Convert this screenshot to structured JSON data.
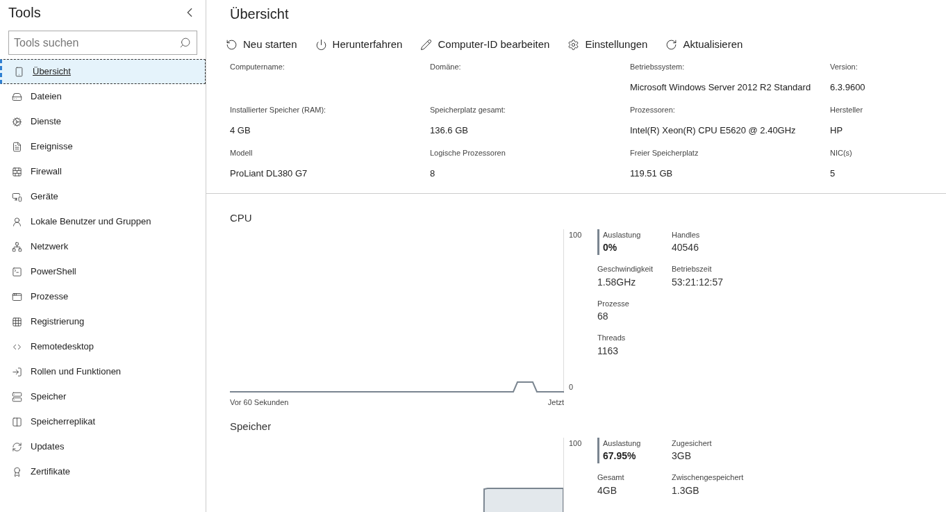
{
  "sidebar": {
    "title": "Tools",
    "search": {
      "placeholder": "Tools suchen"
    },
    "items": [
      {
        "label": "Übersicht",
        "selected": true
      },
      {
        "label": "Dateien",
        "selected": false
      },
      {
        "label": "Dienste",
        "selected": false
      },
      {
        "label": "Ereignisse",
        "selected": false
      },
      {
        "label": "Firewall",
        "selected": false
      },
      {
        "label": "Geräte",
        "selected": false
      },
      {
        "label": "Lokale Benutzer und Gruppen",
        "selected": false
      },
      {
        "label": "Netzwerk",
        "selected": false
      },
      {
        "label": "PowerShell",
        "selected": false
      },
      {
        "label": "Prozesse",
        "selected": false
      },
      {
        "label": "Registrierung",
        "selected": false
      },
      {
        "label": "Remotedesktop",
        "selected": false
      },
      {
        "label": "Rollen und Funktionen",
        "selected": false
      },
      {
        "label": "Speicher",
        "selected": false
      },
      {
        "label": "Speicherreplikat",
        "selected": false
      },
      {
        "label": "Updates",
        "selected": false
      },
      {
        "label": "Zertifikate",
        "selected": false
      }
    ]
  },
  "main": {
    "title": "Übersicht",
    "toolbar": [
      "Neu starten",
      "Herunterfahren",
      "Computer-ID bearbeiten",
      "Einstellungen",
      "Aktualisieren"
    ],
    "info": [
      {
        "label": "Computername:"
      },
      {
        "label": "Domäne:"
      },
      {
        "label": "Betriebssystem:",
        "value": "Microsoft Windows Server 2012 R2 Standard"
      },
      {
        "label": "Version:",
        "value": "6.3.9600"
      },
      {
        "label": "Installierter Speicher (RAM):",
        "value": "4 GB"
      },
      {
        "label": "Speicherplatz gesamt:",
        "value": "136.6 GB"
      },
      {
        "label": "Prozessoren:",
        "value": "Intel(R) Xeon(R) CPU E5620 @ 2.40GHz"
      },
      {
        "label": "Hersteller",
        "value": "HP"
      },
      {
        "label": "Modell",
        "value": "ProLiant DL380 G7"
      },
      {
        "label": "Logische Prozessoren",
        "value": "8"
      },
      {
        "label": "Freier Speicherplatz",
        "value": "119.51 GB"
      },
      {
        "label": "NIC(s)",
        "value": "5"
      }
    ],
    "monitors": [
      {
        "title": "CPU",
        "kind": "line",
        "y_max": "100",
        "y_min": "0",
        "x_start": "Vor 60 Sekunden",
        "x_end": "Jetzt",
        "stats": [
          [
            {
              "label": "Auslastung",
              "value": "0%",
              "highlighted": true
            },
            {
              "label": "Handles",
              "value": "40546",
              "highlighted": false
            }
          ],
          [
            {
              "label": "Geschwindigkeit",
              "value": "1.58GHz",
              "highlighted": false
            },
            {
              "label": "Betriebszeit",
              "value": "53:21:12:57",
              "highlighted": false
            }
          ],
          [
            {
              "label": "Prozesse",
              "value": "68",
              "highlighted": false
            }
          ],
          [
            {
              "label": "Threads",
              "value": "1163",
              "highlighted": false
            }
          ]
        ]
      },
      {
        "title": "Speicher",
        "kind": "area",
        "y_max": "100",
        "stats": [
          [
            {
              "label": "Auslastung",
              "value": "67.95%",
              "highlighted": true
            },
            {
              "label": "Zugesichert",
              "value": "3GB",
              "highlighted": false
            }
          ],
          [
            {
              "label": "Gesamt",
              "value": "4GB",
              "highlighted": false
            },
            {
              "label": "Zwischengespeichert",
              "value": "1.3GB",
              "highlighted": false
            }
          ]
        ]
      }
    ]
  }
}
